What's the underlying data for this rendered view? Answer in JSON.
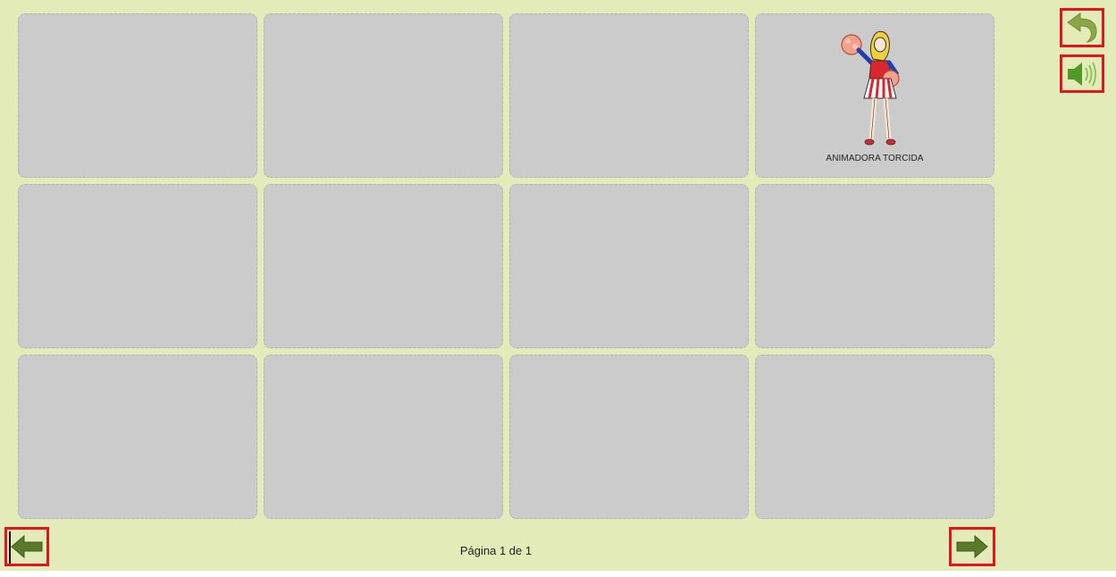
{
  "grid": {
    "cells": [
      {
        "label": ""
      },
      {
        "label": ""
      },
      {
        "label": ""
      },
      {
        "label": "ANIMADORA TORCIDA",
        "icon": "cheerleader-pictogram"
      },
      {
        "label": ""
      },
      {
        "label": ""
      },
      {
        "label": ""
      },
      {
        "label": ""
      },
      {
        "label": ""
      },
      {
        "label": ""
      },
      {
        "label": ""
      },
      {
        "label": ""
      }
    ]
  },
  "toolbar": {
    "undo_icon": "undo-arrow-icon",
    "speak_icon": "speaker-icon"
  },
  "navigation": {
    "prev_icon": "left-arrow-icon",
    "next_icon": "right-arrow-icon",
    "page_text": "Página 1 de 1"
  },
  "colors": {
    "background": "#e3ecb8",
    "cell": "#cbcbcb",
    "highlight_border": "#e5141b",
    "arrow_green": "#5a7a2a"
  }
}
